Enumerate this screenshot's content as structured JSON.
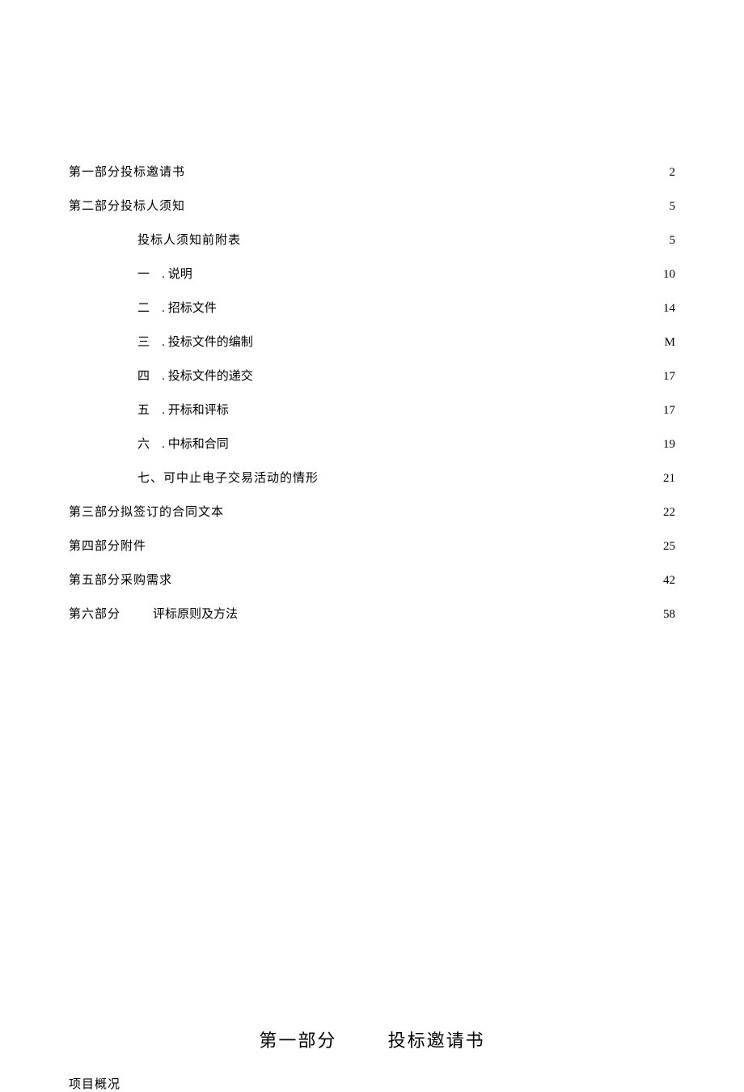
{
  "toc": [
    {
      "indent": 0,
      "label": "第一部分投标邀请书",
      "wide": true,
      "leader": true,
      "page": "2"
    },
    {
      "indent": 0,
      "label": "第二部分投标人须知",
      "wide": true,
      "leader": true,
      "page": "5"
    },
    {
      "indent": 1,
      "label": "投标人须知前附表",
      "leader": true,
      "page": "5"
    },
    {
      "indent": 2,
      "num": "一",
      "dot": ".",
      "title": "说明",
      "leader": false,
      "page": "10"
    },
    {
      "indent": 2,
      "num": "二",
      "dot": ".",
      "title": "招标文件",
      "leader": false,
      "page": "14"
    },
    {
      "indent": 2,
      "num": "三",
      "dot": ".",
      "title": "投标文件的编制",
      "leader": true,
      "page": "M"
    },
    {
      "indent": 2,
      "num": "四",
      "dot": ".",
      "title": "投标文件的递交",
      "leader": true,
      "page": "17"
    },
    {
      "indent": 2,
      "num": "五",
      "dot": ".",
      "title": "开标和评标",
      "leader": true,
      "page": "17"
    },
    {
      "indent": 2,
      "num": "六",
      "dot": ".",
      "title": "中标和合同",
      "leader": false,
      "page": "19"
    },
    {
      "indent": 1,
      "label": "七、可中止电子交易活动的情形",
      "leader": true,
      "page": "21"
    },
    {
      "indent": 0,
      "label": "第三部分拟签订的合同文本",
      "leader": true,
      "page": "22"
    },
    {
      "indent": 0,
      "label": "第四部分附件",
      "leader": false,
      "page": "25"
    },
    {
      "indent": 0,
      "label": "第五部分采购需求",
      "leader": false,
      "page": "42"
    },
    {
      "indent": 0,
      "label": "第六部分",
      "gap": true,
      "title": "评标原则及方法",
      "leader": true,
      "page": "58"
    }
  ],
  "section": {
    "part": "第一部分",
    "title": "投标邀请书"
  },
  "subheading": "项目概况"
}
